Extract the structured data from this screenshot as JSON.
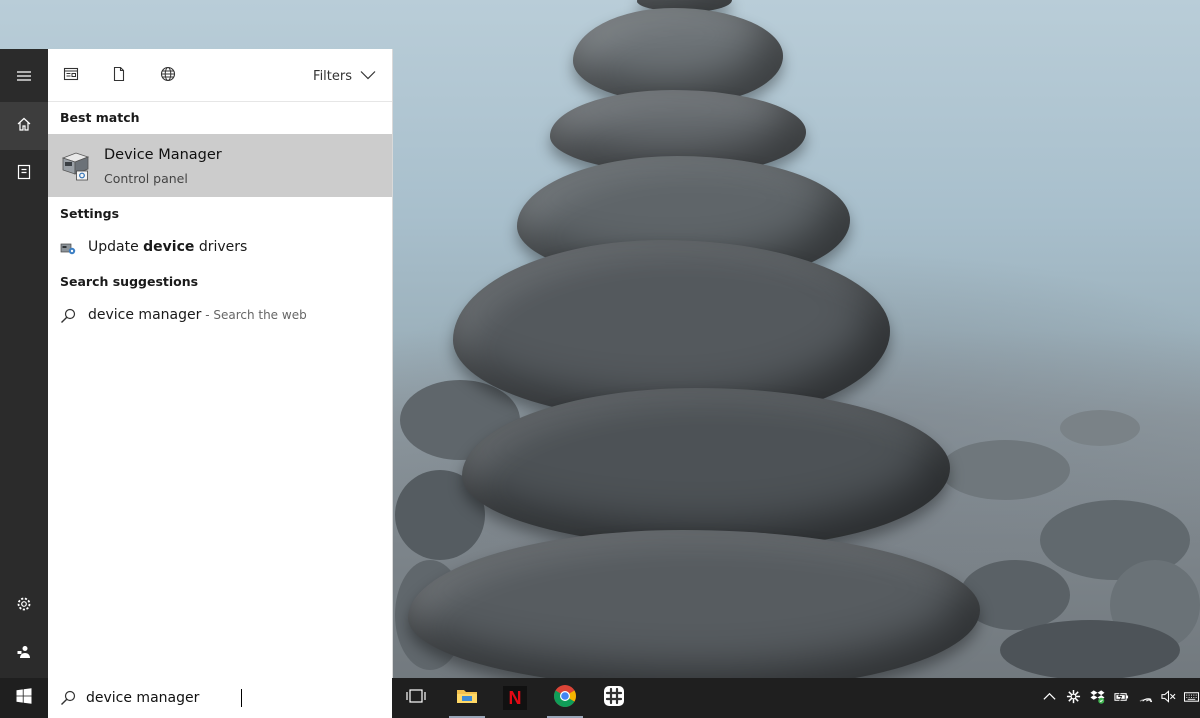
{
  "start_menu": {
    "rail": {
      "items": [
        {
          "name": "expand",
          "icon": "hamburger-icon"
        },
        {
          "name": "home",
          "icon": "home-icon"
        },
        {
          "name": "notebook",
          "icon": "notebook-icon"
        },
        {
          "name": "settings",
          "icon": "gear-icon"
        },
        {
          "name": "feedback",
          "icon": "feedback-icon"
        }
      ]
    },
    "toolbar": {
      "filter_icons": [
        "apps-icon",
        "documents-icon",
        "web-icon"
      ],
      "filters_label": "Filters"
    },
    "best_match": {
      "header": "Best match",
      "title": "Device Manager",
      "subtitle": "Control panel",
      "icon": "device-manager-icon"
    },
    "settings": {
      "header": "Settings",
      "items": [
        {
          "prefix": "Update ",
          "bold": "device",
          "suffix": " drivers",
          "icon": "device-settings-icon"
        }
      ]
    },
    "suggestions": {
      "header": "Search suggestions",
      "items": [
        {
          "query": "device manager",
          "hint": " - Search the web",
          "icon": "search-icon"
        }
      ]
    }
  },
  "taskbar": {
    "search": {
      "value": "device manager",
      "placeholder": ""
    },
    "apps": [
      {
        "name": "task-view",
        "icon": "task-view-icon"
      },
      {
        "name": "file-explorer",
        "icon": "folder-icon"
      },
      {
        "name": "netflix",
        "icon": "netflix-icon",
        "glyph": "N"
      },
      {
        "name": "chrome",
        "icon": "chrome-icon"
      },
      {
        "name": "slack",
        "icon": "slack-icon"
      }
    ],
    "tray": [
      "chevron-up-icon",
      "network-settings-icon",
      "dropbox-icon",
      "battery-icon",
      "wifi-icon",
      "volume-muted-icon",
      "keyboard-icon"
    ]
  },
  "colors": {
    "rail_bg": "#2b2b2b",
    "taskbar_bg": "#1f1f1f",
    "selected_bg": "#cccccc",
    "netflix_red": "#e50914"
  }
}
